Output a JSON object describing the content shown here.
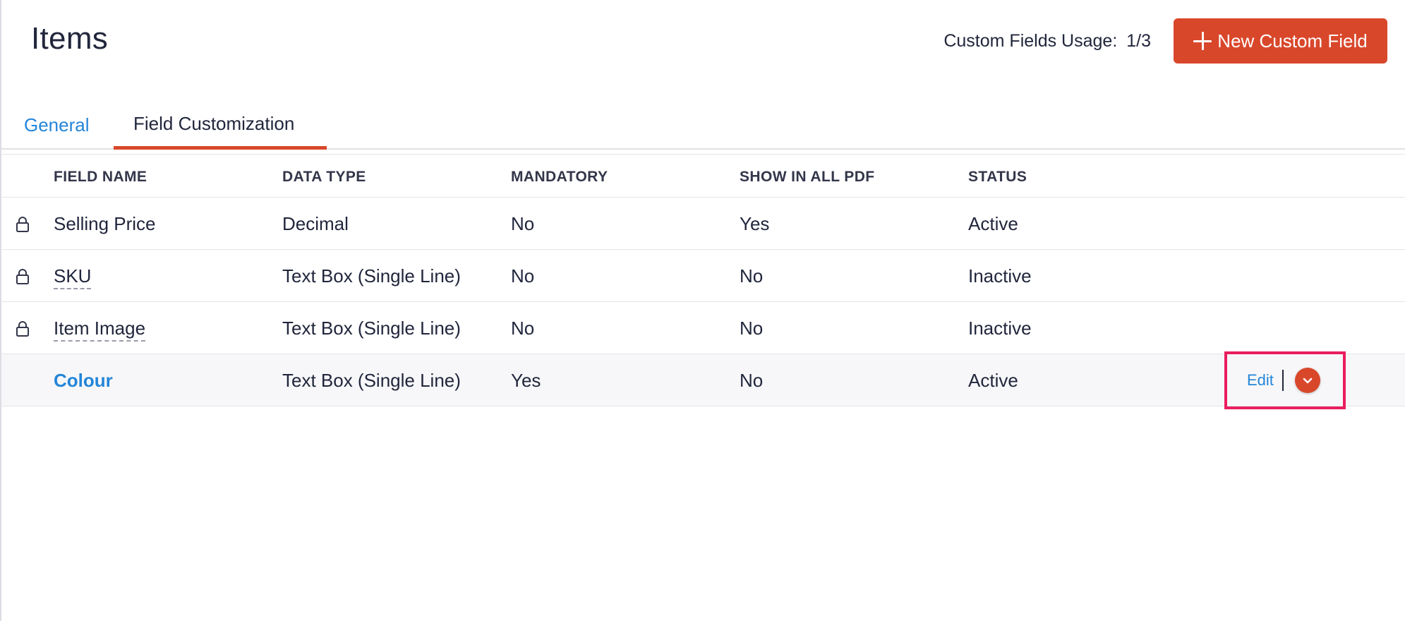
{
  "header": {
    "title": "Items",
    "usage_label": "Custom Fields Usage:",
    "usage_count": "1/3",
    "new_button_label": "New Custom Field"
  },
  "tabs": [
    {
      "label": "General",
      "active": false
    },
    {
      "label": "Field Customization",
      "active": true
    }
  ],
  "table": {
    "columns": [
      "FIELD NAME",
      "DATA TYPE",
      "MANDATORY",
      "SHOW IN ALL PDF",
      "STATUS"
    ],
    "rows": [
      {
        "field_name": "Selling Price",
        "data_type": "Decimal",
        "mandatory": "No",
        "show_in_all_pdf": "Yes",
        "status": "Active",
        "locked": true
      },
      {
        "field_name": "SKU",
        "data_type": "Text Box (Single Line)",
        "mandatory": "No",
        "show_in_all_pdf": "No",
        "status": "Inactive",
        "locked": true
      },
      {
        "field_name": "Item Image",
        "data_type": "Text Box (Single Line)",
        "mandatory": "No",
        "show_in_all_pdf": "No",
        "status": "Inactive",
        "locked": true
      },
      {
        "field_name": "Colour",
        "data_type": "Text Box (Single Line)",
        "mandatory": "Yes",
        "show_in_all_pdf": "No",
        "status": "Active",
        "locked": false
      }
    ],
    "row_actions": {
      "edit_label": "Edit"
    }
  },
  "colors": {
    "accent": "#d9472b",
    "link": "#2485d8",
    "highlight_border": "#ea1d5e",
    "text": "#21263c"
  },
  "icons": {
    "lock": "lock-icon",
    "plus": "plus-icon",
    "chevron": "chevron-down-icon"
  }
}
